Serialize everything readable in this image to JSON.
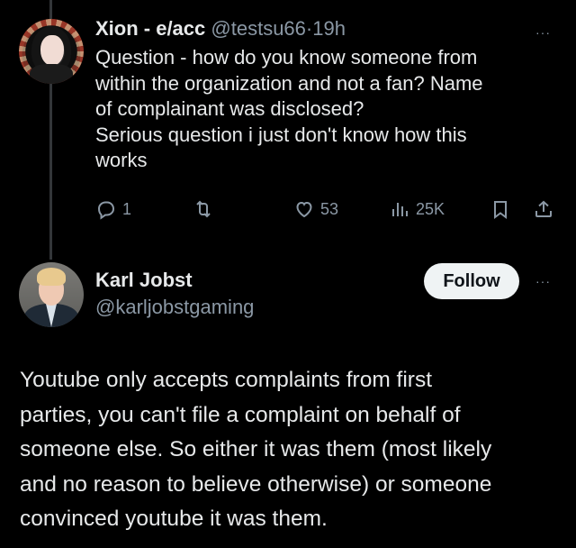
{
  "tweet1": {
    "display_name": "Xion - e/acc",
    "handle": "@testsu66",
    "separator": "·",
    "time": "19h",
    "more": "···",
    "text_lines": [
      "Question - how do you know someone from",
      "within the organization and not a fan? Name",
      "of complainant was disclosed?",
      "Serious question i just don't know how this",
      "works"
    ],
    "actions": {
      "replies": "1",
      "reposts": "",
      "likes": "53",
      "views": "25K"
    }
  },
  "tweet2": {
    "display_name": "Karl Jobst",
    "handle": "@karljobstgaming",
    "follow_label": "Follow",
    "more": "···",
    "text_lines": [
      "Youtube only accepts complaints from first",
      "parties, you can't file a complaint on behalf of",
      "someone else. So either it was them (most likely",
      "and no reason to believe otherwise) or someone",
      "convinced youtube it was them."
    ]
  },
  "icons": {
    "reply": "reply-icon",
    "repost": "repost-icon",
    "like": "heart-icon",
    "views": "views-icon",
    "bookmark": "bookmark-icon",
    "share": "share-icon"
  },
  "colors": {
    "background": "#000000",
    "text": "#e7e9ea",
    "muted": "#8b98a5",
    "follow_bg": "#eff3f4"
  }
}
